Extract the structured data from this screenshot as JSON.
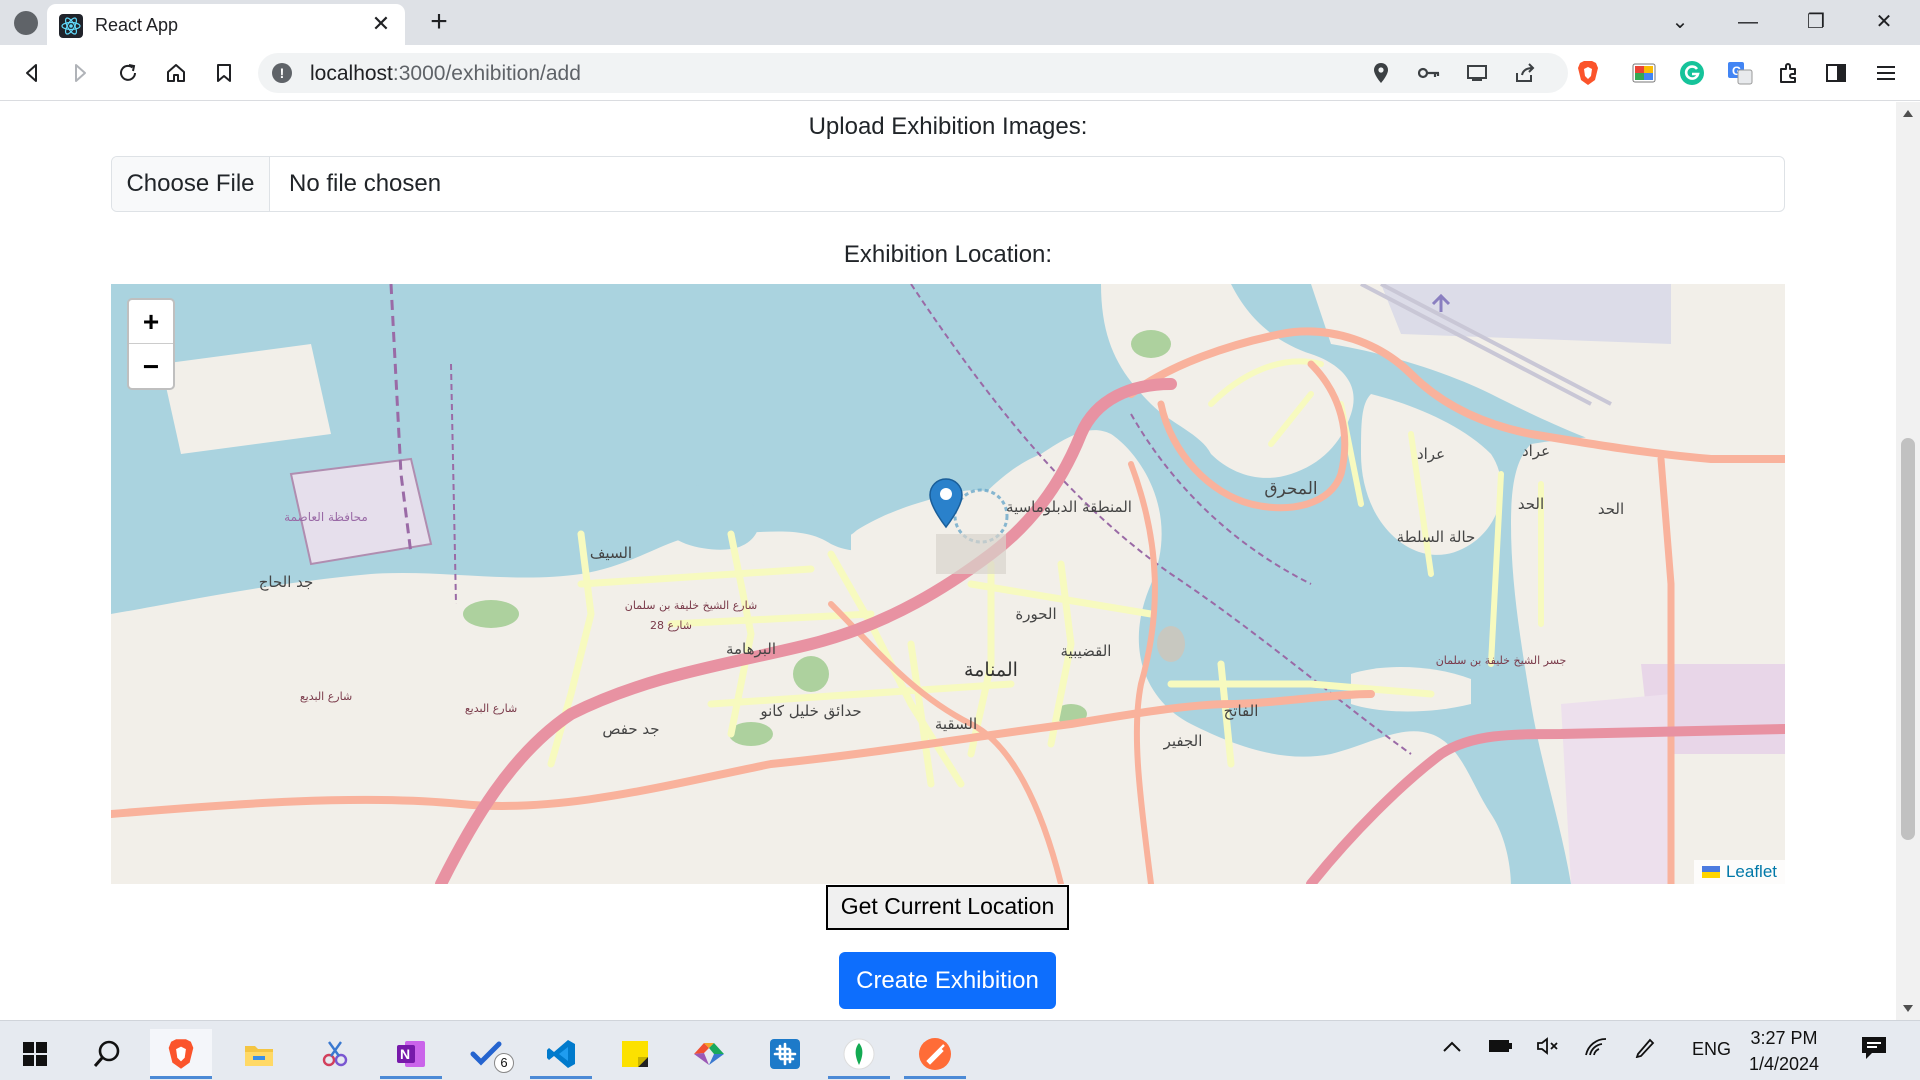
{
  "browser": {
    "tab_title": "React App",
    "url_host": "localhost",
    "url_rest": ":3000/exhibition/add"
  },
  "form": {
    "images_label": "Upload Exhibition Images:",
    "file_button": "Choose File",
    "file_status": "No file chosen",
    "location_label": "Exhibition Location:",
    "get_location_button": "Get Current Location",
    "create_button": "Create Exhibition"
  },
  "map": {
    "zoom_in": "+",
    "zoom_out": "−",
    "attribution": "Leaflet",
    "place_labels": [
      "المنطقة الدبلوماسية",
      "المحرق",
      "عراد",
      "الحد",
      "حالة السلطة",
      "السيف",
      "جد الحاج",
      "محافظة العاصمة",
      "الحورة",
      "البرهامة",
      "القضيبية",
      "المنامة",
      "حدائق خليل كانو",
      "جد حفص",
      "السقية",
      "الفاتح",
      "الجفير",
      "شارع الشيخ خليفة بن سلمان",
      "جسر الشيخ خليفة بن سلمان",
      "شارع البديع",
      "شارع 28"
    ]
  },
  "taskbar": {
    "vscode_badge": "6",
    "lang": "ENG",
    "time": "3:27 PM",
    "date": "1/4/2024"
  },
  "colors": {
    "primary": "#0d6efd",
    "water": "#aad3df",
    "land": "#f2efe9",
    "motorway": "#e892a2",
    "trunk": "#f9b29c",
    "primary_road": "#fcd6a4",
    "secondary_road": "#f7fabf",
    "marker": "#2a81cb"
  }
}
